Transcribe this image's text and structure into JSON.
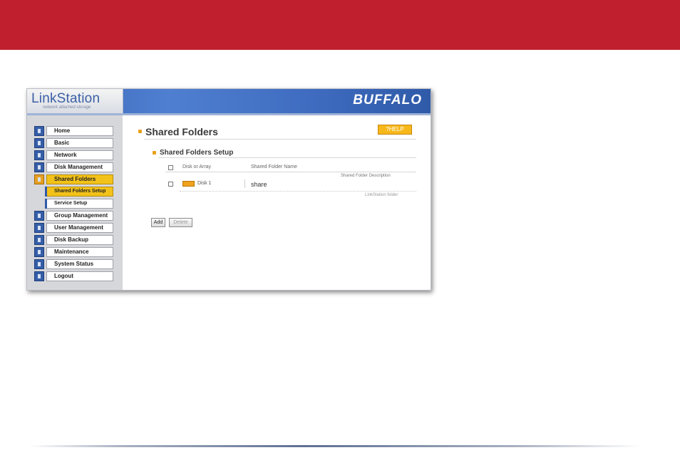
{
  "colors": {
    "banner": "#c0202e",
    "accent": "#f3c21a",
    "header_blue": "#3f6cc0"
  },
  "app": {
    "logo_text": "LinkStation",
    "logo_subtitle": "network attached storage",
    "brand": "BUFFALO"
  },
  "sidebar": {
    "items": [
      {
        "label": "Home",
        "icon": "home-icon",
        "active": false
      },
      {
        "label": "Basic",
        "icon": "basic-settings-icon",
        "active": false
      },
      {
        "label": "Network",
        "icon": "network-icon",
        "active": false
      },
      {
        "label": "Disk Management",
        "icon": "disk-icon",
        "active": false
      },
      {
        "label": "Shared Folders",
        "icon": "folder-icon",
        "active": true
      },
      {
        "label": "Group Management",
        "icon": "group-icon",
        "active": false
      },
      {
        "label": "User Management",
        "icon": "user-icon",
        "active": false
      },
      {
        "label": "Disk Backup",
        "icon": "backup-icon",
        "active": false
      },
      {
        "label": "Maintenance",
        "icon": "maintenance-icon",
        "active": false
      },
      {
        "label": "System Status",
        "icon": "status-icon",
        "active": false
      },
      {
        "label": "Logout",
        "icon": "logout-icon",
        "active": false
      }
    ],
    "subitems": [
      {
        "label": "Shared Folders Setup",
        "active": true
      },
      {
        "label": "Service Setup",
        "active": false
      }
    ]
  },
  "main": {
    "title": "Shared Folders",
    "help_label": "?HELP",
    "section_title": "Shared Folders Setup",
    "table": {
      "headers": {
        "disk": "Disk or Array",
        "name": "Shared Folder Name",
        "description": "Shared Folder Description"
      },
      "rows": [
        {
          "disk": "Disk 1",
          "name": "share",
          "description": "LinkStation folder"
        }
      ]
    },
    "buttons": {
      "add": "Add",
      "delete": "Delete"
    }
  }
}
